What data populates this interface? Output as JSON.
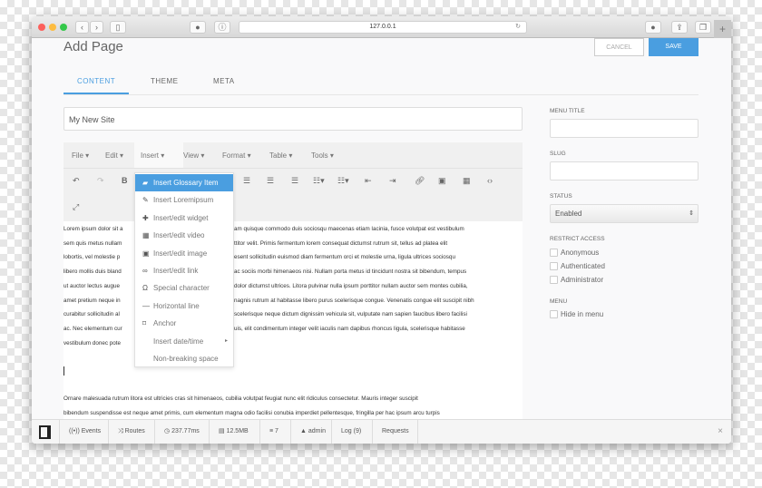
{
  "browser": {
    "url": "127.0.0.1",
    "colors": {
      "close": "#fc605c",
      "min": "#fdbc40",
      "max": "#34c84a"
    }
  },
  "page": {
    "title": "Add Page",
    "cancel": "CANCEL",
    "save": "SAVE",
    "accent": "#4a9ee0"
  },
  "tabs": [
    {
      "label": "CONTENT",
      "active": true
    },
    {
      "label": "THEME"
    },
    {
      "label": "META"
    }
  ],
  "title_input": "My New Site",
  "editor": {
    "menubar": [
      "File",
      "Edit",
      "Insert",
      "View",
      "Format",
      "Table",
      "Tools"
    ],
    "insert_menu": [
      {
        "label": "Insert Glossary Item",
        "icon": "book-icon",
        "highlighted": true
      },
      {
        "label": "Insert Loremipsum",
        "icon": "pencil-icon"
      },
      {
        "label": "Insert/edit widget",
        "icon": "puzzle-icon"
      },
      {
        "label": "Insert/edit video",
        "icon": "video-icon"
      },
      {
        "label": "Insert/edit image",
        "icon": "image-icon"
      },
      {
        "label": "Insert/edit link",
        "icon": "link-icon"
      },
      {
        "label": "Special character",
        "icon": "omega-icon"
      },
      {
        "label": "Horizontal line",
        "icon": "hr-icon"
      },
      {
        "label": "Anchor",
        "icon": "bookmark-icon"
      },
      {
        "label": "Insert date/time",
        "icon": "",
        "submenu": true
      },
      {
        "label": "Non-breaking space",
        "icon": ""
      }
    ],
    "lines": [
      {
        "l": "Lorem ipsum dolor sit a",
        "r": "am quisque commodo duis sociosqu maecenas etiam lacinia, fusce volutpat est vestibulum"
      },
      {
        "l": "sem quis metus nullam",
        "r": "ttitor velit. Primis fermentum lorem consequat dictumst rutrum sit, tellus ad platea elit"
      },
      {
        "l": "lobortis, vel molestie p",
        "r": "esent sollicitudin euismod diam fermentum orci et molestie urna, ligula ultrices sociosqu"
      },
      {
        "l": "libero mollis duis bland",
        "r": "ac sociis morbi himenaeos nisi. Nullam porta metus id tincidunt nostra sit bibendum, tempus"
      },
      {
        "l": "ut auctor lectus augue",
        "r": "dolor dictumst ultrices. Litora pulvinar nulla ipsum porttitor nullam auctor sem montes cubilia,"
      },
      {
        "l": "amet pretium neque in",
        "r": "nagnis rutrum at habitasse libero purus scelerisque congue. Venenatis congue elit suscipit nibh"
      },
      {
        "l": "curabitur sollicitudin al",
        "r": "scelerisque neque dictum dignissim vehicula sit, vulputate nam sapien faucibus libero facilisi"
      },
      {
        "l": "ac. Nec elementum cur",
        "r": "uis, elit condimentum integer velit iaculis nam dapibus rhoncus ligula, scelerisque habitasse"
      },
      {
        "l": "vestibulum donec pote",
        "r": ""
      }
    ],
    "para2": [
      "Ornare malesuada rutrum litora est ultricies cras sit himenaeos, cubilia volutpat feugiat nunc elit ridiculus consectetur. Mauris integer suscipit",
      "bibendum suspendisse est neque amet primis, cum elementum magna odio facilisi conubia imperdiet pellentesque, fringilla per hac ipsum arcu turpis"
    ]
  },
  "sidebar": {
    "menu_title": "MENU TITLE",
    "slug": "SLUG",
    "status": "STATUS",
    "status_value": "Enabled",
    "restrict": "RESTRICT ACCESS",
    "roles": [
      "Anonymous",
      "Authenticated",
      "Administrator"
    ],
    "menu": "MENU",
    "hide": "Hide in menu"
  },
  "debugbar": [
    {
      "icon": "broadcast-icon",
      "g": "((•))",
      "label": "Events"
    },
    {
      "icon": "shuffle-icon",
      "g": "⤨",
      "label": "Routes"
    },
    {
      "icon": "clock-icon",
      "g": "◷",
      "label": "237.77ms"
    },
    {
      "icon": "memory-icon",
      "g": "▤",
      "label": "12.5MB"
    },
    {
      "icon": "database-icon",
      "g": "≡",
      "label": "7"
    },
    {
      "icon": "user-icon",
      "g": "▲",
      "label": "admin"
    },
    {
      "icon": "",
      "g": "",
      "label": "Log (9)"
    },
    {
      "icon": "",
      "g": "",
      "label": "Requests"
    }
  ],
  "debug_close": "×"
}
